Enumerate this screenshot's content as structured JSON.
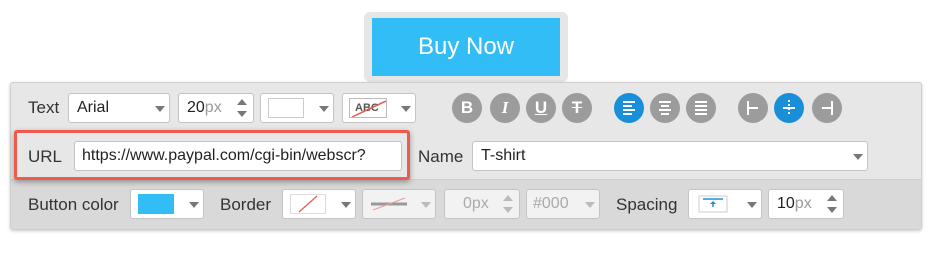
{
  "preview": {
    "button_label": "Buy Now"
  },
  "toolbar": {
    "text_label": "Text",
    "font": "Arial",
    "font_size": "20",
    "font_size_unit": "px",
    "text_color": "#ffffff",
    "text_shadow_icon_text": "ABC",
    "bold_glyph": "B",
    "italic_glyph": "I",
    "underline_glyph": "U",
    "strikethrough_glyph": "T"
  },
  "link": {
    "url_label": "URL",
    "url_value": "https://www.paypal.com/cgi-bin/webscr?",
    "name_label": "Name",
    "name_value": "T-shirt"
  },
  "style": {
    "button_color_label": "Button color",
    "button_color": "#33bdf7",
    "border_label": "Border",
    "border_width": "0",
    "border_width_unit": "px",
    "border_color": "#000",
    "spacing_label": "Spacing",
    "spacing_value": "10",
    "spacing_unit": "px"
  },
  "colors": {
    "accent": "#1a8fd9",
    "highlight": "#ef5a4c",
    "button_preview": "#33bdf7"
  }
}
